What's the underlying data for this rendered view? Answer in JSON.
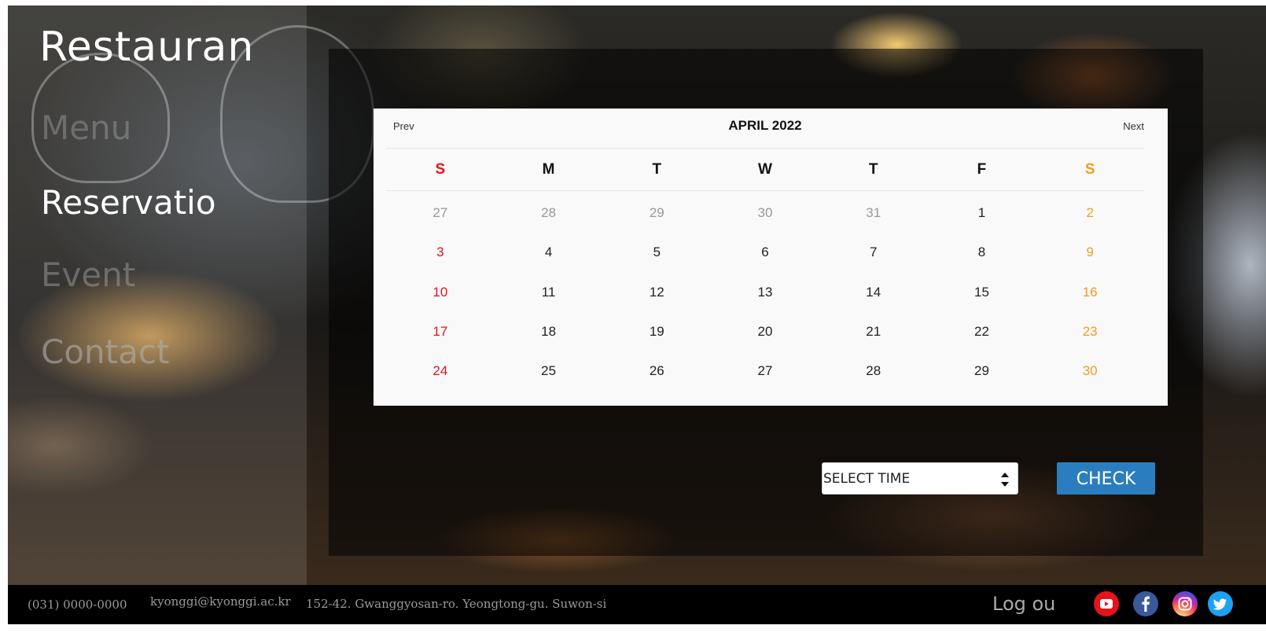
{
  "brand": "Restauran",
  "nav": {
    "menu": "Menu",
    "reservation": "Reservatio",
    "event": "Event",
    "contact": "Contact"
  },
  "calendar": {
    "prev": "Prev",
    "next": "Next",
    "month": "APRIL 2022",
    "weekdays": [
      "S",
      "M",
      "T",
      "W",
      "T",
      "F",
      "S"
    ],
    "weeks": [
      [
        "27",
        "28",
        "29",
        "30",
        "31",
        "1",
        "2"
      ],
      [
        "3",
        "4",
        "5",
        "6",
        "7",
        "8",
        "9"
      ],
      [
        "10",
        "11",
        "12",
        "13",
        "14",
        "15",
        "16"
      ],
      [
        "17",
        "18",
        "19",
        "20",
        "21",
        "22",
        "23"
      ],
      [
        "24",
        "25",
        "26",
        "27",
        "28",
        "29",
        "30"
      ]
    ]
  },
  "controls": {
    "select_time": "SELECT TIME",
    "check": "CHECK"
  },
  "footer": {
    "phone": "(031) 0000-0000",
    "email": "kyonggi@kyonggi.ac.kr",
    "address": "152-42. Gwanggyosan-ro. Yeongtong-gu. Suwon-si",
    "logout": "Log ou"
  },
  "social_icons": [
    "youtube-icon",
    "facebook-icon",
    "instagram-icon",
    "twitter-icon"
  ],
  "colors": {
    "sunday": "#e8121e",
    "saturday": "#f39c1e",
    "check_button": "#2a7ec0"
  }
}
